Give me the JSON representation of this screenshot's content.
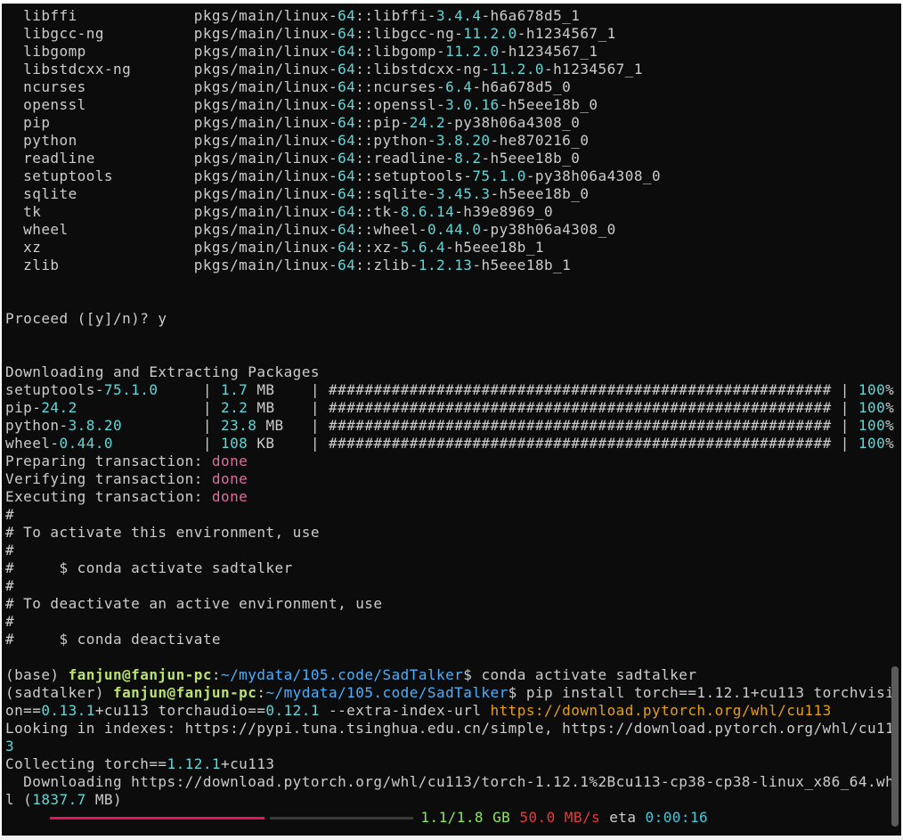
{
  "packages": [
    {
      "name": "libffi",
      "ch": "pkgs/main/linux-",
      "arch": "64",
      "sep": "::",
      "pkg": "libffi-",
      "ver": "3.4.4",
      "build": "-h6a678d5_1"
    },
    {
      "name": "libgcc-ng",
      "ch": "pkgs/main/linux-",
      "arch": "64",
      "sep": "::",
      "pkg": "libgcc-ng-",
      "ver": "11.2.0",
      "build": "-h1234567_1"
    },
    {
      "name": "libgomp",
      "ch": "pkgs/main/linux-",
      "arch": "64",
      "sep": "::",
      "pkg": "libgomp-",
      "ver": "11.2.0",
      "build": "-h1234567_1"
    },
    {
      "name": "libstdcxx-ng",
      "ch": "pkgs/main/linux-",
      "arch": "64",
      "sep": "::",
      "pkg": "libstdcxx-ng-",
      "ver": "11.2.0",
      "build": "-h1234567_1"
    },
    {
      "name": "ncurses",
      "ch": "pkgs/main/linux-",
      "arch": "64",
      "sep": "::",
      "pkg": "ncurses-",
      "ver": "6.4",
      "build": "-h6a678d5_0"
    },
    {
      "name": "openssl",
      "ch": "pkgs/main/linux-",
      "arch": "64",
      "sep": "::",
      "pkg": "openssl-",
      "ver": "3.0.16",
      "build": "-h5eee18b_0"
    },
    {
      "name": "pip",
      "ch": "pkgs/main/linux-",
      "arch": "64",
      "sep": "::",
      "pkg": "pip-",
      "ver": "24.2",
      "build": "-py38h06a4308_0"
    },
    {
      "name": "python",
      "ch": "pkgs/main/linux-",
      "arch": "64",
      "sep": "::",
      "pkg": "python-",
      "ver": "3.8.20",
      "build": "-he870216_0"
    },
    {
      "name": "readline",
      "ch": "pkgs/main/linux-",
      "arch": "64",
      "sep": "::",
      "pkg": "readline-",
      "ver": "8.2",
      "build": "-h5eee18b_0"
    },
    {
      "name": "setuptools",
      "ch": "pkgs/main/linux-",
      "arch": "64",
      "sep": "::",
      "pkg": "setuptools-",
      "ver": "75.1.0",
      "build": "-py38h06a4308_0"
    },
    {
      "name": "sqlite",
      "ch": "pkgs/main/linux-",
      "arch": "64",
      "sep": "::",
      "pkg": "sqlite-",
      "ver": "3.45.3",
      "build": "-h5eee18b_0"
    },
    {
      "name": "tk",
      "ch": "pkgs/main/linux-",
      "arch": "64",
      "sep": "::",
      "pkg": "tk-",
      "ver": "8.6.14",
      "build": "-h39e8969_0"
    },
    {
      "name": "wheel",
      "ch": "pkgs/main/linux-",
      "arch": "64",
      "sep": "::",
      "pkg": "wheel-",
      "ver": "0.44.0",
      "build": "-py38h06a4308_0"
    },
    {
      "name": "xz",
      "ch": "pkgs/main/linux-",
      "arch": "64",
      "sep": "::",
      "pkg": "xz-",
      "ver": "5.6.4",
      "build": "-h5eee18b_1"
    },
    {
      "name": "zlib",
      "ch": "pkgs/main/linux-",
      "arch": "64",
      "sep": "::",
      "pkg": "zlib-",
      "ver": "1.2.13",
      "build": "-h5eee18b_1"
    }
  ],
  "proceed": "Proceed ([y]/n)? y",
  "downloading_header": "Downloading and Extracting Packages",
  "downloads": [
    {
      "pkg": "setuptools-",
      "ver": "75.1.0",
      "size_num": "1.7",
      "size_unit": " MB",
      "percent_num": "100",
      "percent_sign": "%"
    },
    {
      "pkg": "pip-",
      "ver": "24.2",
      "size_num": "2.2",
      "size_unit": " MB",
      "percent_num": "100",
      "percent_sign": "%"
    },
    {
      "pkg": "python-",
      "ver": "3.8.20",
      "size_num": "23.8",
      "size_unit": " MB",
      "percent_num": "100",
      "percent_sign": "%"
    },
    {
      "pkg": "wheel-",
      "ver": "0.44.0",
      "size_num": "108",
      "size_unit": " KB",
      "percent_num": "100",
      "percent_sign": "%"
    }
  ],
  "progress_hashes": "########################################################",
  "transactions": [
    {
      "label": "Preparing transaction: ",
      "status": "done"
    },
    {
      "label": "Verifying transaction: ",
      "status": "done"
    },
    {
      "label": "Executing transaction: ",
      "status": "done"
    }
  ],
  "activate_notes": [
    "#",
    "# To activate this environment, use",
    "#",
    "#     $ conda activate sadtalker",
    "#",
    "# To deactivate an active environment, use",
    "#",
    "#     $ conda deactivate"
  ],
  "prompt1": {
    "env": "(base) ",
    "user": "fanjun@fanjun-pc",
    "colon": ":",
    "path_a": "~/mydata/",
    "path_num": "105",
    "path_b": ".code/SadTalker",
    "dollar": "$ ",
    "cmd": "conda activate sadtalker"
  },
  "prompt2": {
    "env": "(sadtalker) ",
    "user": "fanjun@fanjun-pc",
    "colon": ":",
    "path_a": "~/mydata/",
    "path_num": "105",
    "path_b": ".code/SadTalker",
    "dollar": "$ ",
    "cmd_a": "pip install torch==1.12.1+cu113 torchvisi",
    "cmd_b1": "on==",
    "cmd_b2": "0.13.1",
    "cmd_b3": "+cu113 torchaudio==",
    "cmd_b4": "0.12.1",
    "cmd_b5": " --extra-index-url ",
    "url": "https://download.pytorch.org/whl/cu113"
  },
  "looking_a": "Looking in indexes: https://pypi.tuna.tsinghua.edu.cn/simple, https://download.pytorch.org/whl/cu11",
  "looking_b": "3",
  "collecting_a": "Collecting torch==",
  "collecting_ver": "1.12.1",
  "collecting_b": "+cu113",
  "downloading_a": "  Downloading https://download.pytorch.org/whl/cu113/torch-1.12.1%2Bcu113-cp38-cp38-linux_x86_64.wh",
  "downloading_b_pre": "l (",
  "downloading_b_size": "1837.7",
  "downloading_b_post": " MB)",
  "progress": {
    "fraction": 0.6,
    "done": "1.1/1.8",
    "done_unit": " GB ",
    "speed": "50.0 MB/s",
    "eta_label": " eta ",
    "eta": "0:00:16"
  },
  "colors": {
    "background": "#0c0c0c",
    "text": "#cccccc",
    "number": "#61d6d6",
    "done": "#e06c9d",
    "user": "#bbe36b",
    "path": "#4ab0ff",
    "url": "#e5a00d",
    "progress_bar": "#e0155d"
  }
}
